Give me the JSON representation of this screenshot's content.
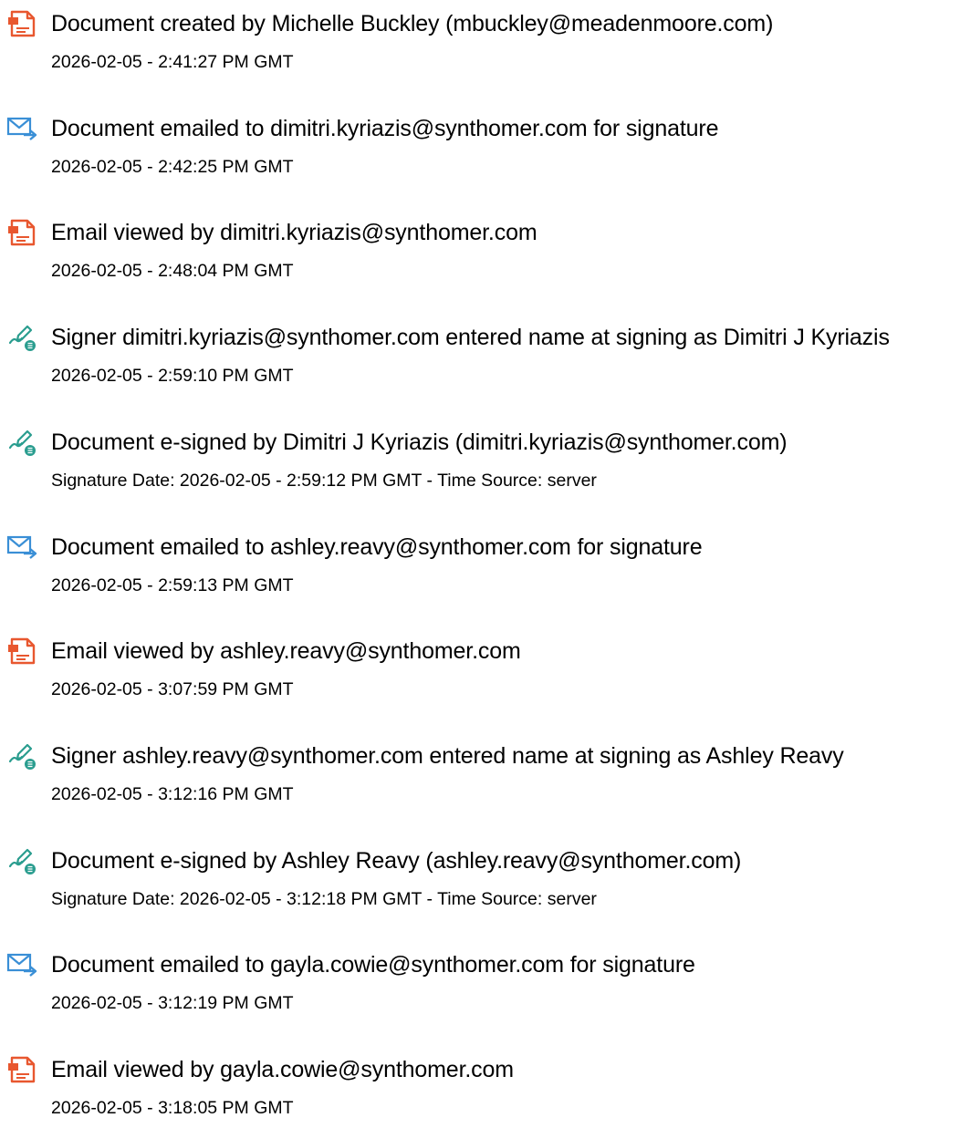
{
  "colors": {
    "document_icon": "#e8572f",
    "email_icon": "#3a8fd6",
    "sign_icon": "#2a9d8f",
    "text": "#000000"
  },
  "entries": [
    {
      "icon": "document-icon",
      "text": "Document created by Michelle Buckley (mbuckley@meadenmoore.com)",
      "detail": "2026-02-05 - 2:41:27 PM GMT"
    },
    {
      "icon": "email-sent-icon",
      "text": "Document emailed to dimitri.kyriazis@synthomer.com for signature",
      "detail": "2026-02-05 - 2:42:25 PM GMT"
    },
    {
      "icon": "document-icon",
      "text": "Email viewed by dimitri.kyriazis@synthomer.com",
      "detail": "2026-02-05 - 2:48:04 PM GMT"
    },
    {
      "icon": "signature-pen-icon",
      "text": "Signer dimitri.kyriazis@synthomer.com entered name at signing as Dimitri J Kyriazis",
      "detail": "2026-02-05 - 2:59:10 PM GMT"
    },
    {
      "icon": "signature-pen-icon",
      "text": "Document e-signed by Dimitri J Kyriazis (dimitri.kyriazis@synthomer.com)",
      "detail": "Signature Date: 2026-02-05 - 2:59:12 PM GMT - Time Source: server"
    },
    {
      "icon": "email-sent-icon",
      "text": "Document emailed to ashley.reavy@synthomer.com for signature",
      "detail": "2026-02-05 - 2:59:13 PM GMT"
    },
    {
      "icon": "document-icon",
      "text": "Email viewed by ashley.reavy@synthomer.com",
      "detail": "2026-02-05 - 3:07:59 PM GMT"
    },
    {
      "icon": "signature-pen-icon",
      "text": "Signer ashley.reavy@synthomer.com entered name at signing as Ashley Reavy",
      "detail": "2026-02-05 - 3:12:16 PM GMT"
    },
    {
      "icon": "signature-pen-icon",
      "text": "Document e-signed by Ashley Reavy (ashley.reavy@synthomer.com)",
      "detail": "Signature Date: 2026-02-05 - 3:12:18 PM GMT - Time Source: server"
    },
    {
      "icon": "email-sent-icon",
      "text": "Document emailed to gayla.cowie@synthomer.com for signature",
      "detail": "2026-02-05 - 3:12:19 PM GMT"
    },
    {
      "icon": "document-icon",
      "text": "Email viewed by gayla.cowie@synthomer.com",
      "detail": "2026-02-05 - 3:18:05 PM GMT"
    }
  ]
}
